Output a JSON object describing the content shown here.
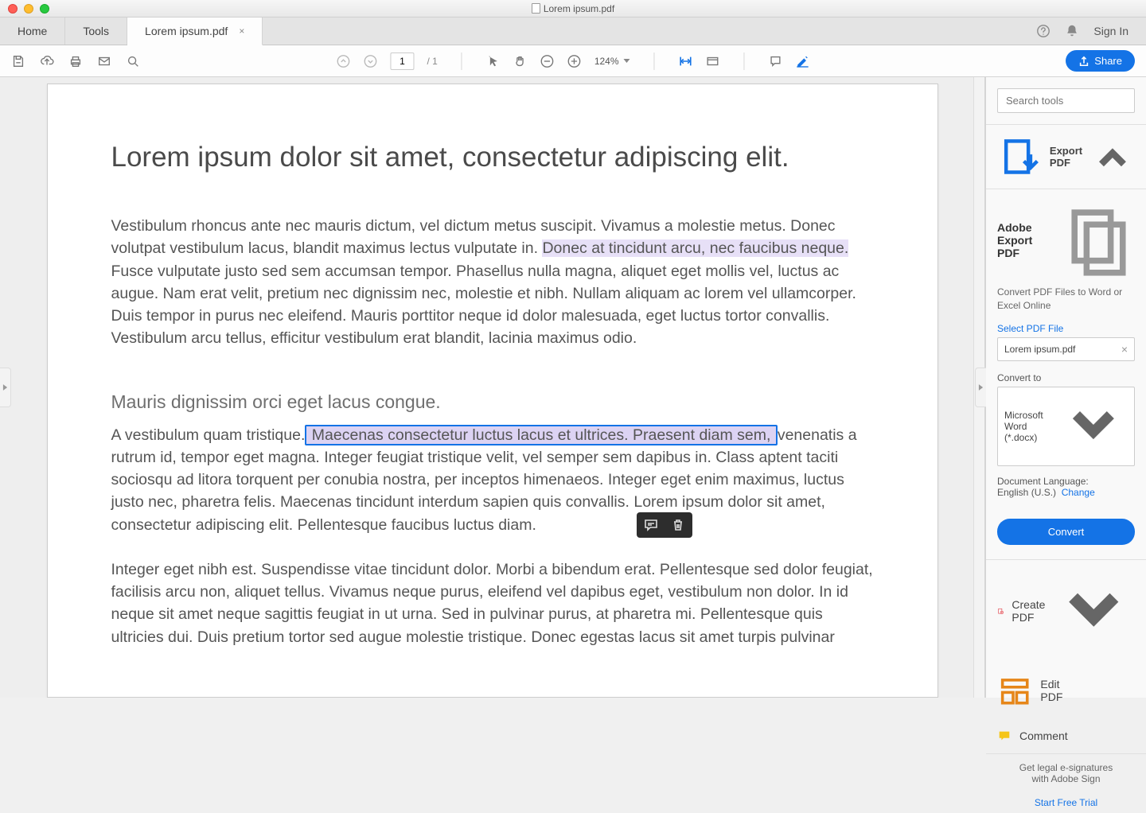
{
  "window": {
    "title": "Lorem ipsum.pdf"
  },
  "tabs": {
    "home": "Home",
    "tools": "Tools",
    "doc": "Lorem ipsum.pdf",
    "close_glyph": "×",
    "signin": "Sign In"
  },
  "toolbar": {
    "page_current": "1",
    "page_sep": "/",
    "page_total": "1",
    "zoom": "124%",
    "share": "Share"
  },
  "document": {
    "h1": "Lorem ipsum dolor sit amet, consectetur adipiscing elit.",
    "p1_a": "Vestibulum rhoncus ante nec mauris dictum, vel dictum metus suscipit. Vivamus a molestie metus. Donec volutpat vestibulum lacus, blandit maximus lectus vulputate in. ",
    "p1_hl": "Donec at tincidunt arcu, nec faucibus neque.",
    "p1_b": " Fusce vulputate justo sed sem accumsan tempor. Phasellus nulla magna, aliquet eget mollis vel, luctus ac augue. Nam erat velit, pretium nec dignissim nec, molestie et nibh. Nullam aliquam ac lorem vel ullamcorper. Duis tempor in purus nec eleifend. Mauris porttitor neque id dolor malesuada, eget luctus tortor convallis. Vestibulum arcu tellus, efficitur vestibulum erat blandit, lacinia maximus odio.",
    "h2": "Mauris dignissim orci eget lacus congue.",
    "p2_a": "A vestibulum quam tristique.",
    "p2_hl": " Maecenas consectetur luctus lacus et ultrices. Praesent diam sem, ",
    "p2_b": "venenatis a rutrum id, tempor eget magna. Integer feugiat tristique velit, vel semper sem dapibus in. Class aptent taciti sociosqu ad litora torquent per conubia nostra, per inceptos himenaeos. Integer eget enim maximus, luctus justo nec, pharetra felis. Maecenas tincidunt interdum sapien quis convallis. Lorem ipsum dolor sit amet, consectetur adipiscing elit. Pellentesque faucibus luctus diam.",
    "p3": "Integer eget nibh est. Suspendisse vitae tincidunt dolor. Morbi a bibendum erat. Pellentesque sed dolor feugiat, facilisis arcu non, aliquet tellus. Vivamus neque purus, eleifend vel dapibus eget, vestibulum non dolor. In id neque sit amet neque sagittis feugiat in ut urna. Sed in pulvinar purus, at pharetra mi. Pellentesque quis ultricies dui. Duis pretium tortor sed augue molestie tristique. Donec egestas lacus sit amet turpis pulvinar"
  },
  "rail": {
    "search_placeholder": "Search tools",
    "export_accordion": "Export PDF",
    "export_title": "Adobe Export PDF",
    "export_sub": "Convert PDF Files to Word or Excel Online",
    "select_label": "Select PDF File",
    "selected_file": "Lorem ipsum.pdf",
    "convert_to_label": "Convert to",
    "convert_to_value": "Microsoft Word (*.docx)",
    "lang_label": "Document Language:",
    "lang_value": "English (U.S.)",
    "lang_change": "Change",
    "convert_btn": "Convert",
    "create_pdf": "Create PDF",
    "edit_pdf": "Edit PDF",
    "comment": "Comment",
    "esign1": "Get legal e-signatures",
    "esign2": "with Adobe Sign",
    "trial": "Start Free Trial"
  }
}
